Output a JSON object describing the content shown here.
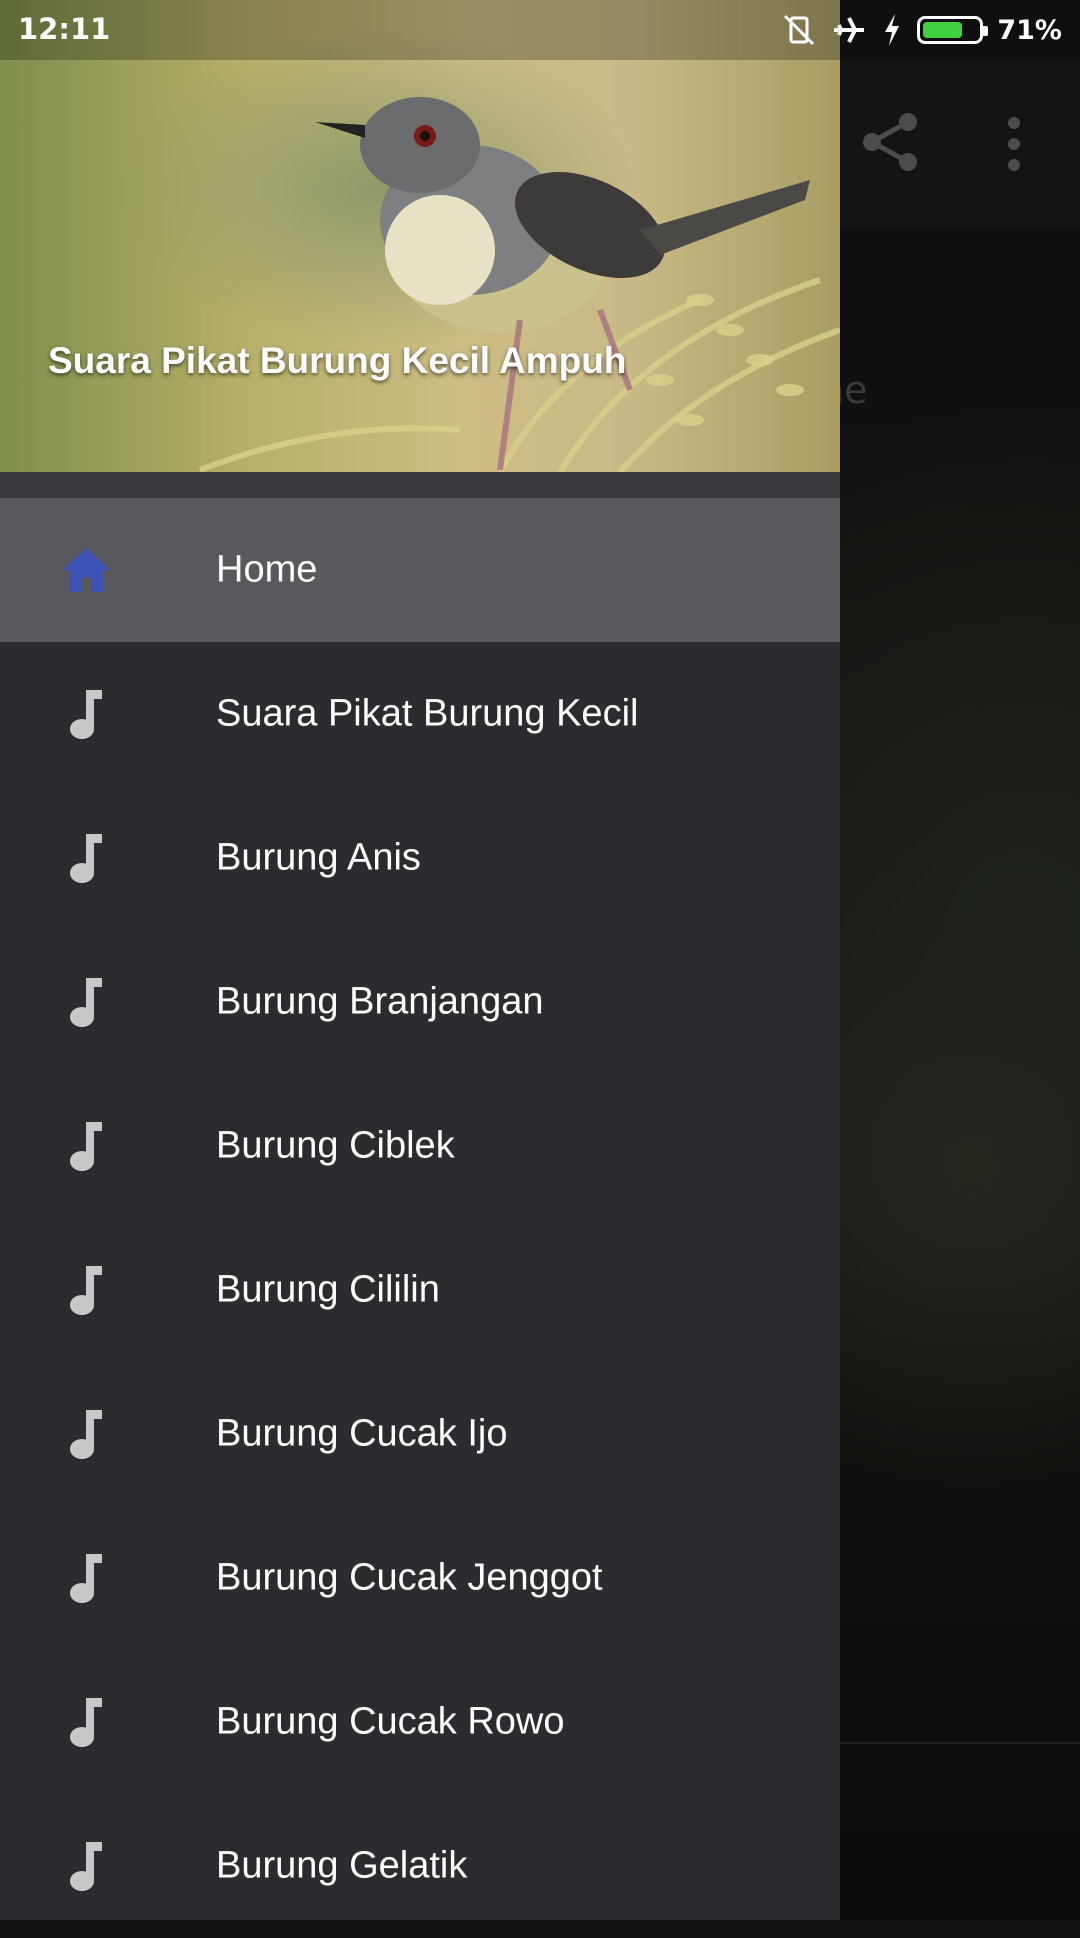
{
  "status_bar": {
    "time": "12:11",
    "battery_percent": "71%",
    "battery_level": 0.71,
    "icons": [
      "vibrate-off-icon",
      "airplane-icon",
      "charging-icon",
      "battery-icon"
    ]
  },
  "background": {
    "partial_text": "ne",
    "toolbar_icons": [
      "share-icon",
      "more-vert-icon"
    ]
  },
  "drawer": {
    "header_title": "Suara Pikat Burung Kecil Ampuh",
    "items": [
      {
        "label": "Home",
        "icon": "home-icon",
        "active": true
      },
      {
        "label": "Suara Pikat Burung Kecil",
        "icon": "music-note-icon"
      },
      {
        "label": "Burung Anis",
        "icon": "music-note-icon"
      },
      {
        "label": "Burung Branjangan",
        "icon": "music-note-icon"
      },
      {
        "label": "Burung Ciblek",
        "icon": "music-note-icon"
      },
      {
        "label": "Burung Cililin",
        "icon": "music-note-icon"
      },
      {
        "label": "Burung Cucak Ijo",
        "icon": "music-note-icon"
      },
      {
        "label": "Burung Cucak Jenggot",
        "icon": "music-note-icon"
      },
      {
        "label": "Burung Cucak Rowo",
        "icon": "music-note-icon"
      },
      {
        "label": "Burung Gelatik",
        "icon": "music-note-icon"
      }
    ]
  },
  "colors": {
    "drawer_bg": "#2c2b2f",
    "active_item_bg": "#59585c",
    "home_icon": "#3f51b5",
    "note_icon": "#c8c8c8"
  }
}
